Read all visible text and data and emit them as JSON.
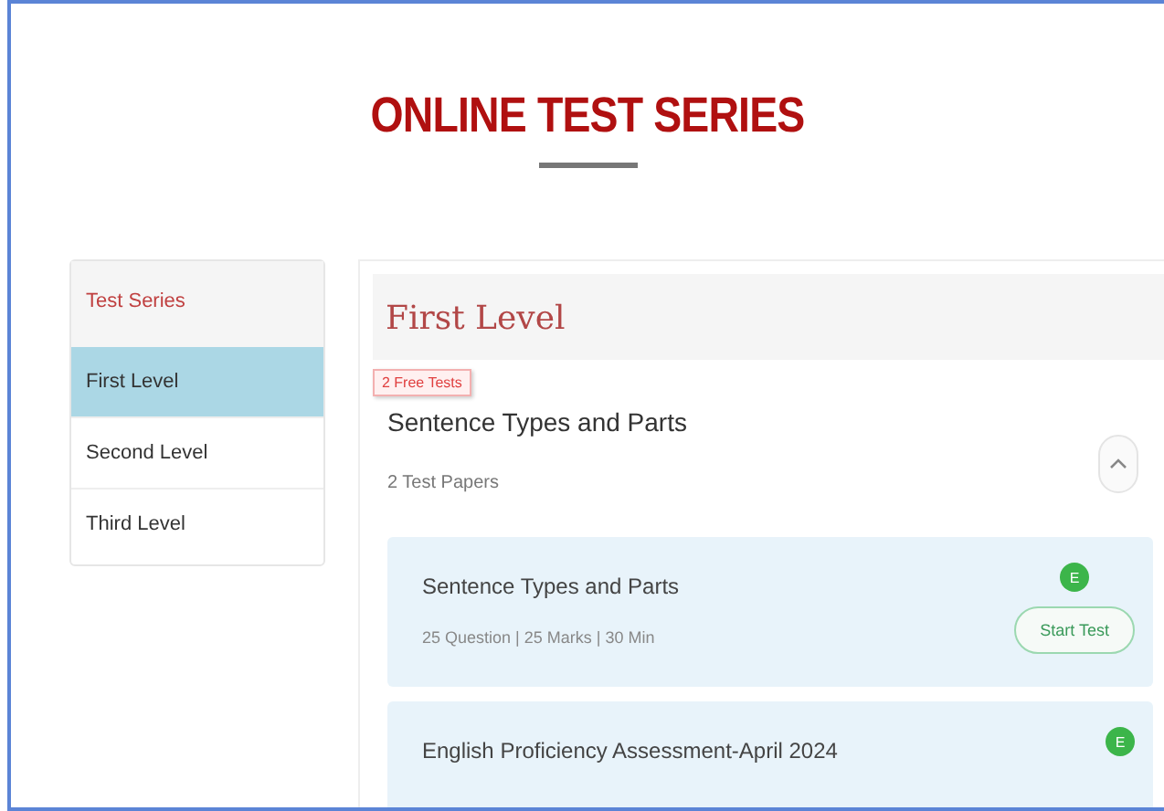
{
  "page_title": "ONLINE TEST SERIES",
  "sidebar": {
    "heading": "Test Series",
    "items": [
      {
        "label": "First Level",
        "selected": true
      },
      {
        "label": "Second Level",
        "selected": false
      },
      {
        "label": "Third Level",
        "selected": false
      }
    ]
  },
  "main": {
    "heading": "First Level",
    "badge": "2 Free Tests",
    "series": {
      "title": "Sentence Types and Parts",
      "papers": "2 Test Papers",
      "expanded": true
    },
    "tests": [
      {
        "title": "Sentence Types and Parts",
        "meta": "25 Question |  25 Marks | 30 Min",
        "tag": "E",
        "button": "Start Test"
      },
      {
        "title": "English Proficiency Assessment-April 2024",
        "tag": "E"
      }
    ]
  }
}
